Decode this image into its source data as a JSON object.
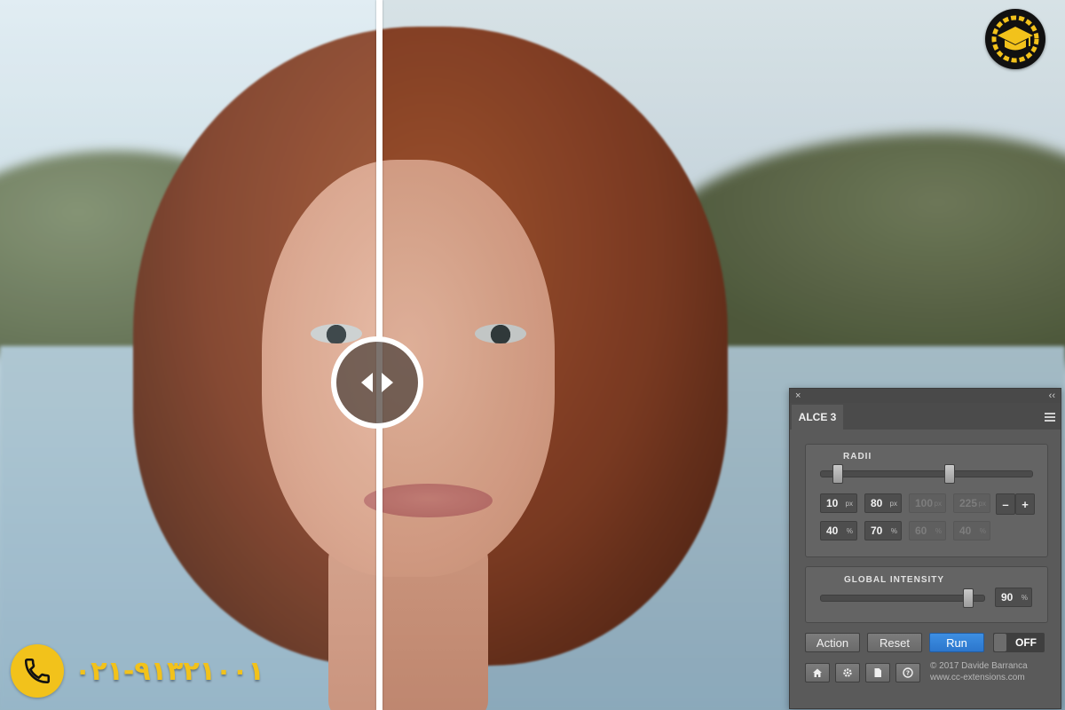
{
  "panel": {
    "close_glyph": "×",
    "collapse_glyph": "‹‹",
    "tab_label": "ALCE 3",
    "radii_title": "RADII",
    "radii_slider": [
      0.08,
      0.61
    ],
    "radii_row1": [
      {
        "value": "10",
        "unit": "px",
        "enabled": true
      },
      {
        "value": "80",
        "unit": "px",
        "enabled": true
      },
      {
        "value": "100",
        "unit": "px",
        "enabled": false
      },
      {
        "value": "225",
        "unit": "px",
        "enabled": false
      }
    ],
    "radii_row2": [
      {
        "value": "40",
        "unit": "%",
        "enabled": true
      },
      {
        "value": "70",
        "unit": "%",
        "enabled": true
      },
      {
        "value": "60",
        "unit": "%",
        "enabled": false
      },
      {
        "value": "40",
        "unit": "%",
        "enabled": false
      }
    ],
    "minus_label": "–",
    "plus_label": "+",
    "intensity_title": "GLOBAL INTENSITY",
    "intensity_value": "90",
    "intensity_unit": "%",
    "intensity_fraction": 0.9,
    "action_label": "Action",
    "reset_label": "Reset",
    "run_label": "Run",
    "toggle_label": "OFF",
    "credits_line1": "© 2017 Davide Barranca",
    "credits_line2": "www.cc-extensions.com",
    "icons": [
      "home-icon",
      "gear-icon",
      "document-icon",
      "help-icon"
    ]
  },
  "overlay": {
    "phone_number": "۰۲۱-۹۱۳۲۱۰۰۱",
    "logo_name": "graduation-cap-gear-logo"
  },
  "colors": {
    "accent_blue": "#2f80d8",
    "phone_yellow": "#f2c21b",
    "panel_bg": "#5a5a5a"
  }
}
